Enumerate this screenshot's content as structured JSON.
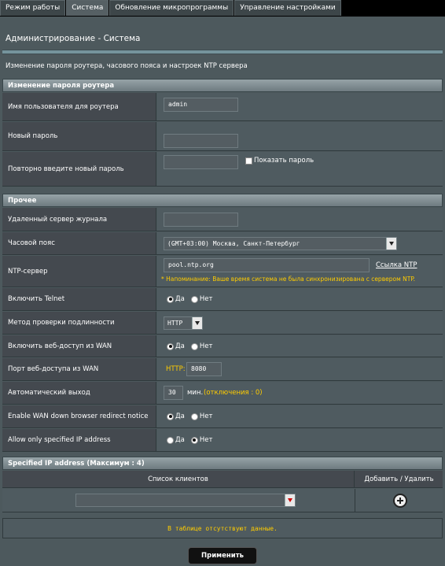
{
  "tabs": [
    "Режим работы",
    "Система",
    "Обновление микропрограммы",
    "Управление настройками"
  ],
  "page": {
    "title": "Администрирование - Система",
    "description": "Изменение пароля роутера, часового пояса и настроек NTP сервера"
  },
  "password_section": {
    "header": "Изменение пароля роутера",
    "username_label": "Имя пользователя для роутера",
    "username_value": "admin",
    "new_password_label": "Новый пароль",
    "new_password_value": "",
    "confirm_label": "Повторно введите новый пароль",
    "confirm_value": "",
    "show_password_label": "Показать пароль"
  },
  "misc_section": {
    "header": "Прочее",
    "remote_log_label": "Удаленный сервер журнала",
    "remote_log_value": "",
    "timezone_label": "Часовой пояс",
    "timezone_value": "(GMT+03:00) Москва, Санкт-Петербург",
    "ntp_label": "NTP-сервер",
    "ntp_value": "pool.ntp.org",
    "ntp_link": "Ссылка NTP",
    "ntp_warning": "* Напоминание: Ваше время система не была синхронизирована с сервером NTP.",
    "telnet_label": "Включить Telnet",
    "auth_label": "Метод проверки подлинности",
    "auth_value": "HTTP",
    "wan_access_label": "Включить веб-доступ из WAN",
    "wan_port_label": "Порт веб-доступа из WAN",
    "wan_port_prefix": "HTTP:",
    "wan_port_value": "8080",
    "autologout_label": "Автоматический выход",
    "autologout_value": "30",
    "autologout_unit": "мин.",
    "autologout_hint": "(отключения : 0)",
    "wan_redirect_label": "Enable WAN down browser redirect notice",
    "allow_ip_label": "Allow only specified IP address",
    "yes": "Да",
    "no": "Нет"
  },
  "radios": {
    "telnet": "yes",
    "wan_access": "yes",
    "wan_redirect": "yes",
    "allow_ip": "no"
  },
  "ip_section": {
    "header": "Specified IP address (Максимум : 4)",
    "col_clients": "Список клиентов",
    "col_action": "Добавить / Удалить",
    "client_value": "",
    "no_data": "В таблице отсутствуют данные."
  },
  "apply_button": "Применить",
  "colors": {
    "warning": "#ffcc00",
    "header_bg": "#6e7b80",
    "panel_bg": "#4d595d"
  }
}
